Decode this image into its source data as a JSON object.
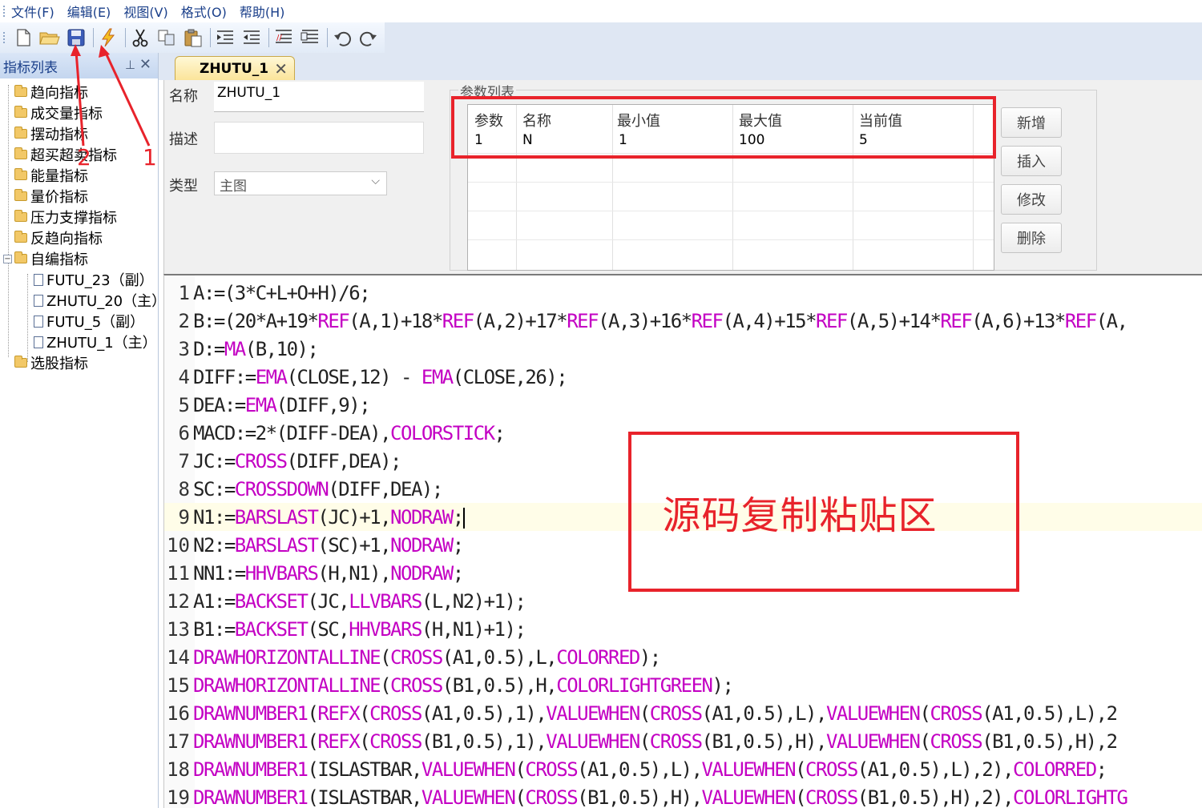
{
  "menu": [
    "文件(F)",
    "编辑(E)",
    "视图(V)",
    "格式(O)",
    "帮助(H)"
  ],
  "toolbar": {
    "icons": [
      "new-file-icon",
      "open-folder-icon",
      "save-icon",
      "compile-icon",
      "cut-icon",
      "copy-icon",
      "paste-icon",
      "indent-icon",
      "outdent-icon",
      "comment-icon",
      "uncomment-icon",
      "undo-icon",
      "redo-icon"
    ]
  },
  "panel": {
    "title": "指标列表",
    "pin": "⊥",
    "close": "✕"
  },
  "tree": {
    "folders": [
      "趋向指标",
      "成交量指标",
      "摆动指标",
      "超买超卖指标",
      "能量指标",
      "量价指标",
      "压力支撑指标",
      "反趋向指标",
      "自编指标",
      "选股指标"
    ],
    "custom_items": [
      "FUTU_23（副）",
      "ZHUTU_20（主）",
      "FUTU_5（副）",
      "ZHUTU_1（主）"
    ]
  },
  "tab": {
    "title": "ZHUTU_1",
    "close": "✕"
  },
  "form": {
    "name_label": "名称",
    "name_value": "ZHUTU_1",
    "desc_label": "描述",
    "desc_value": "",
    "type_label": "类型",
    "type_value": "主图"
  },
  "params": {
    "group_title": "参数列表",
    "headers": [
      "参数",
      "名称",
      "最小值",
      "最大值",
      "当前值"
    ],
    "rows": [
      [
        "1",
        "N",
        "1",
        "100",
        "5"
      ]
    ]
  },
  "buttons": {
    "add": "新增",
    "insert": "插入",
    "modify": "修改",
    "delete": "删除"
  },
  "code_lines": [
    [
      [
        "t",
        "A:=(3*C+L+O+H)/6;"
      ]
    ],
    [
      [
        "t",
        "B:=(20*A+19*"
      ],
      [
        "f",
        "REF"
      ],
      [
        "t",
        "(A,1)+18*"
      ],
      [
        "f",
        "REF"
      ],
      [
        "t",
        "(A,2)+17*"
      ],
      [
        "f",
        "REF"
      ],
      [
        "t",
        "(A,3)+16*"
      ],
      [
        "f",
        "REF"
      ],
      [
        "t",
        "(A,4)+15*"
      ],
      [
        "f",
        "REF"
      ],
      [
        "t",
        "(A,5)+14*"
      ],
      [
        "f",
        "REF"
      ],
      [
        "t",
        "(A,6)+13*"
      ],
      [
        "f",
        "REF"
      ],
      [
        "t",
        "(A,"
      ]
    ],
    [
      [
        "t",
        "D:="
      ],
      [
        "f",
        "MA"
      ],
      [
        "t",
        "(B,10);"
      ]
    ],
    [
      [
        "t",
        "DIFF:="
      ],
      [
        "f",
        "EMA"
      ],
      [
        "t",
        "(CLOSE,12) - "
      ],
      [
        "f",
        "EMA"
      ],
      [
        "t",
        "(CLOSE,26);"
      ]
    ],
    [
      [
        "t",
        "DEA:="
      ],
      [
        "f",
        "EMA"
      ],
      [
        "t",
        "(DIFF,9);"
      ]
    ],
    [
      [
        "t",
        "MACD:=2*(DIFF-DEA),"
      ],
      [
        "f",
        "COLORSTICK"
      ],
      [
        "t",
        ";"
      ]
    ],
    [
      [
        "t",
        "JC:="
      ],
      [
        "f",
        "CROSS"
      ],
      [
        "t",
        "(DIFF,DEA);"
      ]
    ],
    [
      [
        "t",
        "SC:="
      ],
      [
        "f",
        "CROSSDOWN"
      ],
      [
        "t",
        "(DIFF,DEA);"
      ]
    ],
    [
      [
        "t",
        "N1:="
      ],
      [
        "f",
        "BARSLAST"
      ],
      [
        "t",
        "(JC)+1,"
      ],
      [
        "f",
        "NODRAW"
      ],
      [
        "t",
        ";"
      ]
    ],
    [
      [
        "t",
        "N2:="
      ],
      [
        "f",
        "BARSLAST"
      ],
      [
        "t",
        "(SC)+1,"
      ],
      [
        "f",
        "NODRAW"
      ],
      [
        "t",
        ";"
      ]
    ],
    [
      [
        "t",
        "NN1:="
      ],
      [
        "f",
        "HHVBARS"
      ],
      [
        "t",
        "(H,N1),"
      ],
      [
        "f",
        "NODRAW"
      ],
      [
        "t",
        ";"
      ]
    ],
    [
      [
        "t",
        "A1:="
      ],
      [
        "f",
        "BACKSET"
      ],
      [
        "t",
        "(JC,"
      ],
      [
        "f",
        "LLVBARS"
      ],
      [
        "t",
        "(L,N2)+1);"
      ]
    ],
    [
      [
        "t",
        "B1:="
      ],
      [
        "f",
        "BACKSET"
      ],
      [
        "t",
        "(SC,"
      ],
      [
        "f",
        "HHVBARS"
      ],
      [
        "t",
        "(H,N1)+1);"
      ]
    ],
    [
      [
        "f",
        "DRAWHORIZONTALLINE"
      ],
      [
        "t",
        "("
      ],
      [
        "f",
        "CROSS"
      ],
      [
        "t",
        "(A1,0.5),L,"
      ],
      [
        "f",
        "COLORRED"
      ],
      [
        "t",
        ");"
      ]
    ],
    [
      [
        "f",
        "DRAWHORIZONTALLINE"
      ],
      [
        "t",
        "("
      ],
      [
        "f",
        "CROSS"
      ],
      [
        "t",
        "(B1,0.5),H,"
      ],
      [
        "f",
        "COLORLIGHTGREEN"
      ],
      [
        "t",
        ");"
      ]
    ],
    [
      [
        "f",
        "DRAWNUMBER1"
      ],
      [
        "t",
        "("
      ],
      [
        "f",
        "REFX"
      ],
      [
        "t",
        "("
      ],
      [
        "f",
        "CROSS"
      ],
      [
        "t",
        "(A1,0.5),1),"
      ],
      [
        "f",
        "VALUEWHEN"
      ],
      [
        "t",
        "("
      ],
      [
        "f",
        "CROSS"
      ],
      [
        "t",
        "(A1,0.5),L),"
      ],
      [
        "f",
        "VALUEWHEN"
      ],
      [
        "t",
        "("
      ],
      [
        "f",
        "CROSS"
      ],
      [
        "t",
        "(A1,0.5),L),2"
      ]
    ],
    [
      [
        "f",
        "DRAWNUMBER1"
      ],
      [
        "t",
        "("
      ],
      [
        "f",
        "REFX"
      ],
      [
        "t",
        "("
      ],
      [
        "f",
        "CROSS"
      ],
      [
        "t",
        "(B1,0.5),1),"
      ],
      [
        "f",
        "VALUEWHEN"
      ],
      [
        "t",
        "("
      ],
      [
        "f",
        "CROSS"
      ],
      [
        "t",
        "(B1,0.5),H),"
      ],
      [
        "f",
        "VALUEWHEN"
      ],
      [
        "t",
        "("
      ],
      [
        "f",
        "CROSS"
      ],
      [
        "t",
        "(B1,0.5),H),2"
      ]
    ],
    [
      [
        "f",
        "DRAWNUMBER1"
      ],
      [
        "t",
        "(ISLASTBAR,"
      ],
      [
        "f",
        "VALUEWHEN"
      ],
      [
        "t",
        "("
      ],
      [
        "f",
        "CROSS"
      ],
      [
        "t",
        "(A1,0.5),L),"
      ],
      [
        "f",
        "VALUEWHEN"
      ],
      [
        "t",
        "("
      ],
      [
        "f",
        "CROSS"
      ],
      [
        "t",
        "(A1,0.5),L),2),"
      ],
      [
        "f",
        "COLORRED"
      ],
      [
        "t",
        ";"
      ]
    ],
    [
      [
        "f",
        "DRAWNUMBER1"
      ],
      [
        "t",
        "(ISLASTBAR,"
      ],
      [
        "f",
        "VALUEWHEN"
      ],
      [
        "t",
        "("
      ],
      [
        "f",
        "CROSS"
      ],
      [
        "t",
        "(B1,0.5),H),"
      ],
      [
        "f",
        "VALUEWHEN"
      ],
      [
        "t",
        "("
      ],
      [
        "f",
        "CROSS"
      ],
      [
        "t",
        "(B1,0.5),H),2),"
      ],
      [
        "f",
        "COLORLIGHTG"
      ]
    ]
  ],
  "annotations": {
    "paste_area_label": "源码复制粘贴区",
    "arrow_1": "1",
    "arrow_2": "2",
    "color": "#e8232b"
  },
  "colors": {
    "keyword": "#c300c3",
    "menu_text": "#1a3f8a"
  }
}
